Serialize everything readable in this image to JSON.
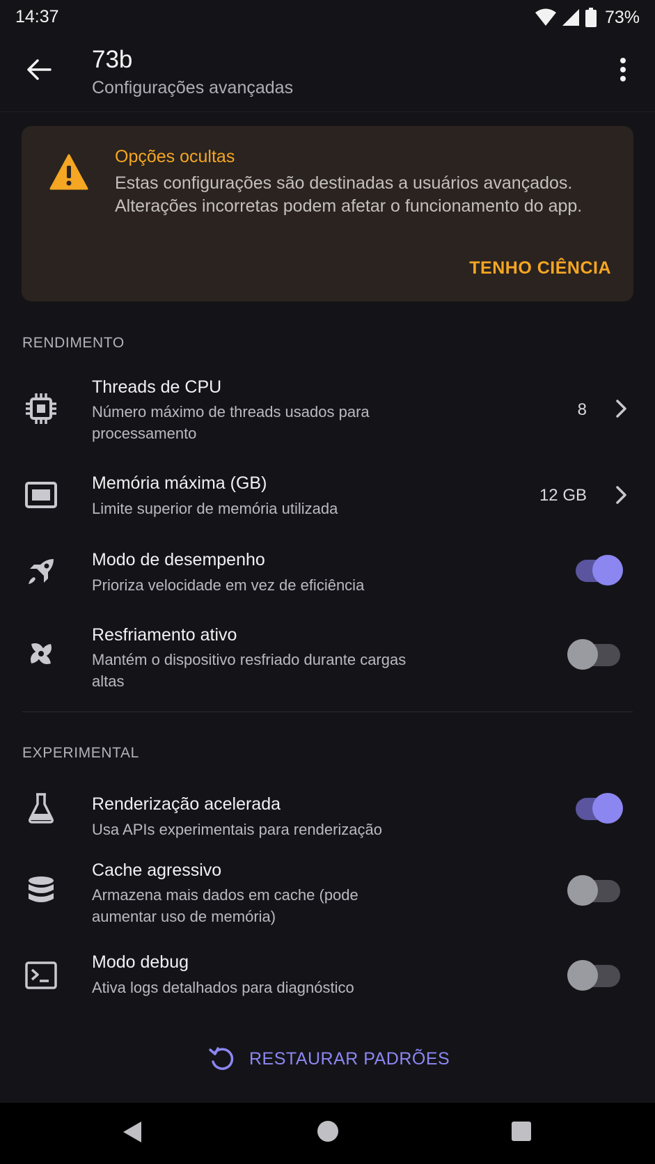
{
  "status_bar": {
    "time": "14:37",
    "battery": "73%"
  },
  "app_bar": {
    "title": "73b",
    "subtitle": "Configurações avançadas"
  },
  "warning": {
    "title": "Opções ocultas",
    "text": "Estas configurações são destinadas a usuários avançados. Alterações incorretas podem afetar o funcionamento do app.",
    "action": "TENHO CIÊNCIA",
    "accent_color": "#f5a623"
  },
  "sections": {
    "performance": {
      "header": "RENDIMENTO",
      "items": [
        {
          "title": "Threads de CPU",
          "description": "Número máximo de threads usados para processamento",
          "value": "8",
          "icon": "cpu-icon"
        },
        {
          "title": "Memória máxima (GB)",
          "description": "Limite superior de memória utilizada",
          "value": "12 GB",
          "icon": "memory-icon"
        },
        {
          "title": "Modo de desempenho",
          "description": "Prioriza velocidade em vez de eficiência",
          "enabled": true,
          "icon": "rocket-icon"
        },
        {
          "title": "Resfriamento ativo",
          "description": "Mantém o dispositivo resfriado durante cargas altas",
          "enabled": false,
          "icon": "fan-icon"
        }
      ]
    },
    "experimental": {
      "header": "EXPERIMENTAL",
      "items": [
        {
          "title": "Renderização acelerada",
          "description": "Usa APIs experimentais para renderização",
          "enabled": true,
          "icon": "flask-icon"
        },
        {
          "title": "Cache agressivo",
          "description": "Armazena mais dados em cache (pode aumentar uso de memória)",
          "enabled": false,
          "icon": "database-icon"
        },
        {
          "title": "Modo debug",
          "description": "Ativa logs detalhados para diagnóstico",
          "enabled": false,
          "icon": "terminal-icon"
        }
      ]
    }
  },
  "restore_button": {
    "label": "RESTAURAR PADRÕES"
  },
  "theme": {
    "background": "#141418",
    "accent": "#8b86f0",
    "warning": "#f5a623"
  }
}
